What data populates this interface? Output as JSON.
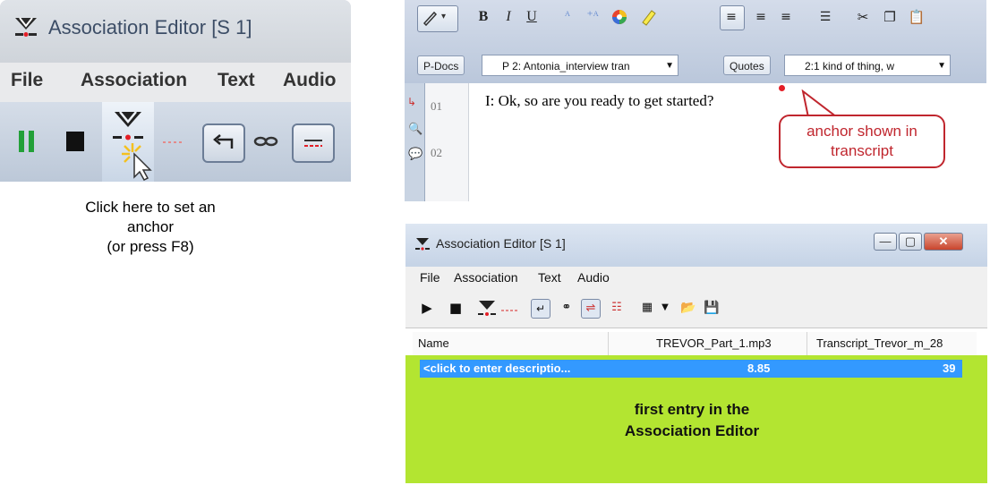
{
  "zoom_panel": {
    "title": "Association Editor [S 1]",
    "menu": [
      "File",
      "Association",
      "Text",
      "Audio"
    ],
    "icons": [
      "play-icon",
      "stop-icon",
      "set-anchor-icon",
      "anchor-gap-icon",
      "undo-icon",
      "link-icon",
      "sync-icon"
    ]
  },
  "hint": {
    "line1": "Click here to set an",
    "line2": "anchor",
    "line3": "(or press F8)"
  },
  "editor": {
    "pdocs_label": "P-Docs",
    "doc_combo": "P 2: Antonia_interview tran",
    "quotes_label": "Quotes",
    "quote_combo": "2:1 kind of thing, w",
    "line_numbers": [
      "01",
      "02"
    ],
    "line1_text": "I: Ok, so are you ready to get started?",
    "callout_line1": "anchor shown in",
    "callout_line2": "transcript",
    "colors": {
      "anchor": "#e41e26",
      "callout": "#c0262e"
    }
  },
  "assoc_window": {
    "title": "Association Editor [S 1]",
    "menu": [
      "File",
      "Association",
      "Text",
      "Audio"
    ],
    "columns": [
      "Name",
      "TREVOR_Part_1.mp3",
      "Transcript_Trevor_m_28"
    ],
    "row": {
      "name": "<click to enter descriptio...",
      "audio": "8.85",
      "transcript": "39"
    },
    "caption_line1": "first entry in the",
    "caption_line2": "Association Editor",
    "colors": {
      "selection": "#3399ff",
      "background": "#b3e531"
    }
  }
}
